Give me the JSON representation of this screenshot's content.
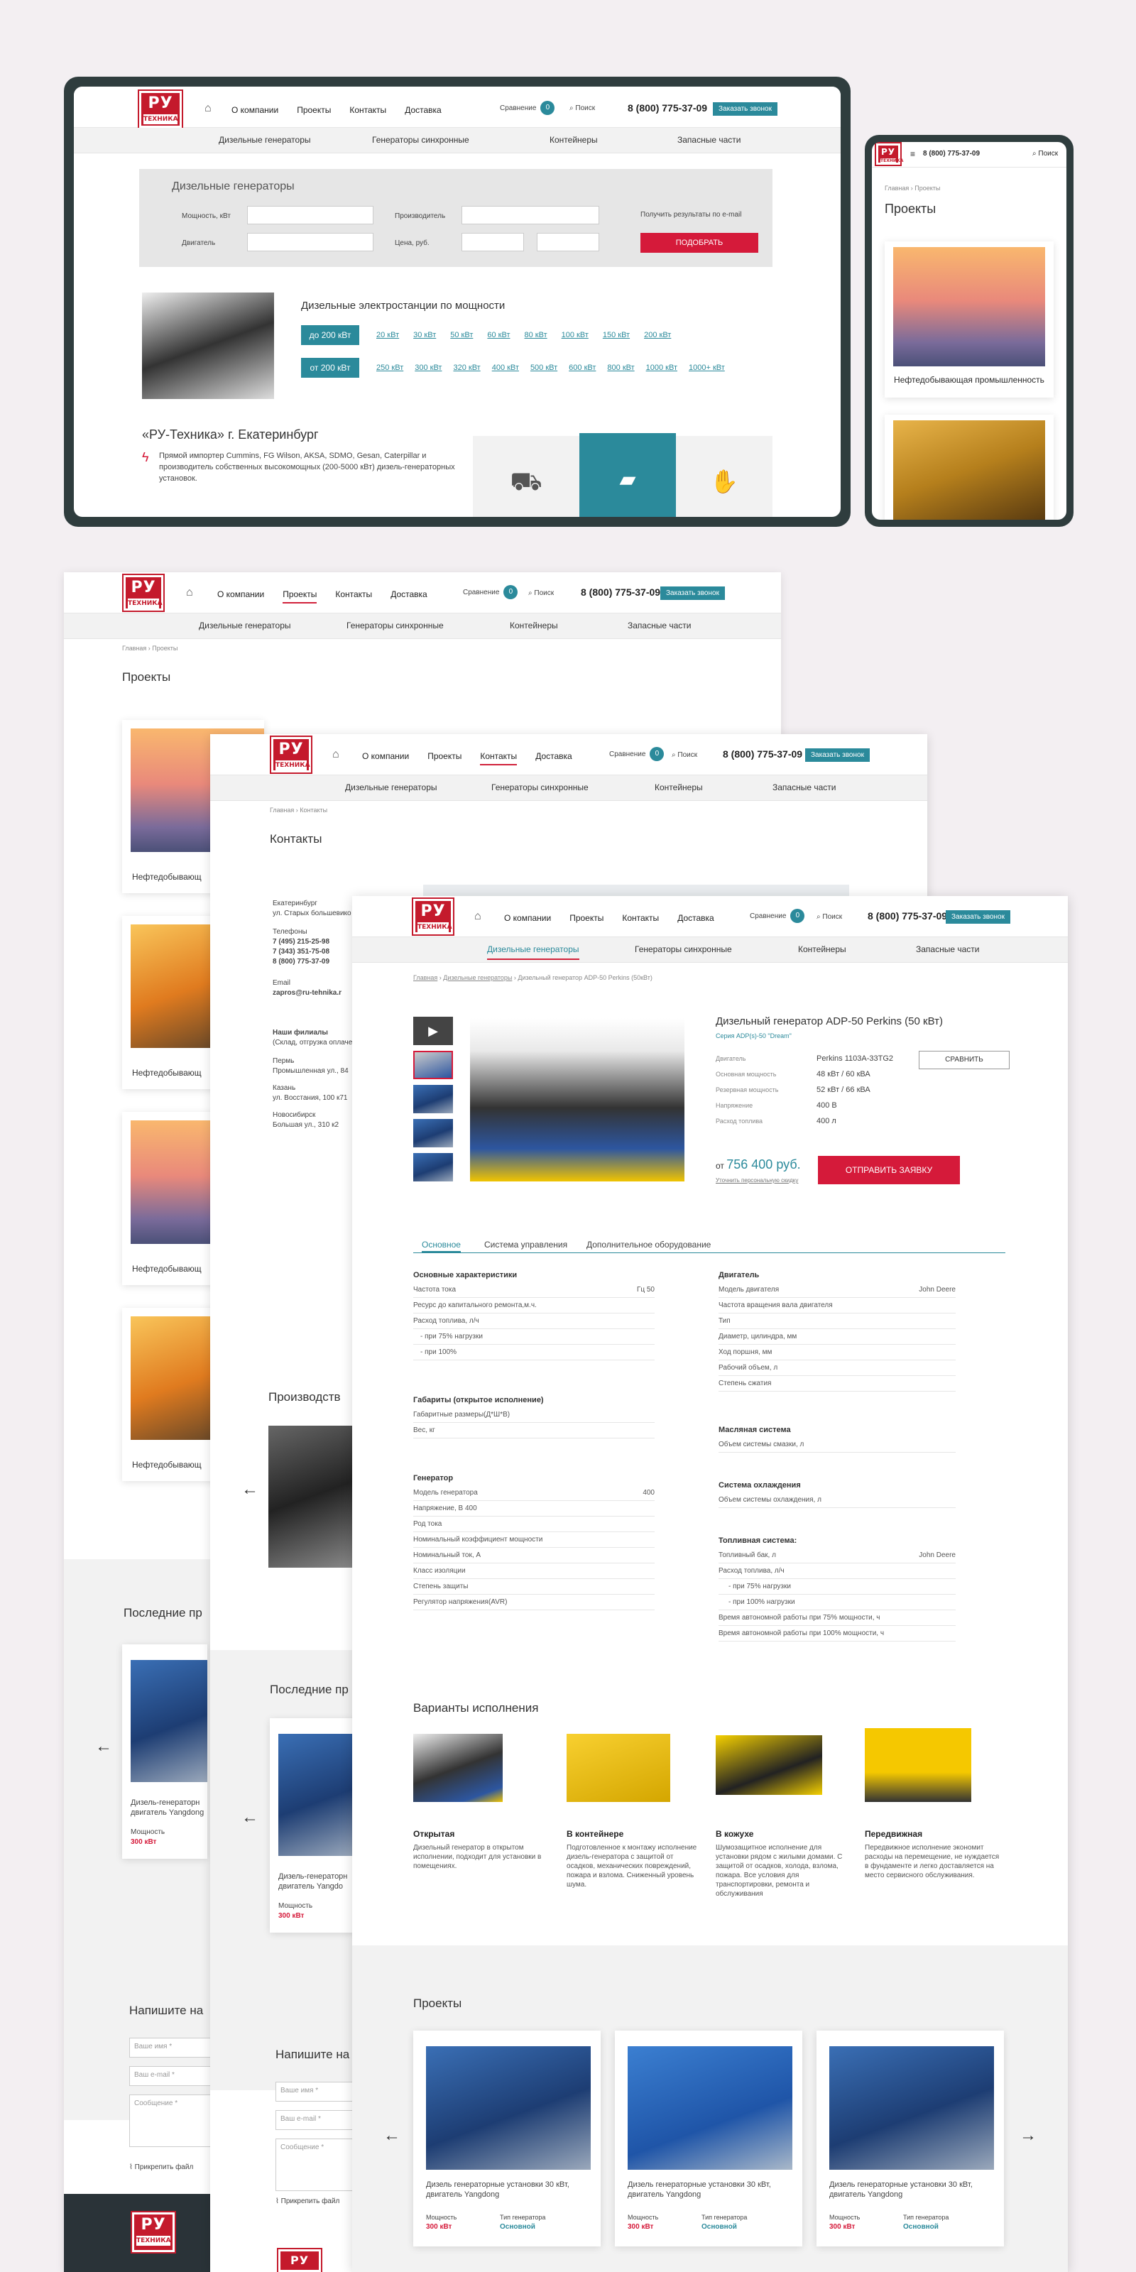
{
  "company": {
    "logo_top": "РУ",
    "logo_bottom": "ТЕХНИКА"
  },
  "nav": {
    "about": "О компании",
    "projects": "Проекты",
    "contacts": "Контакты",
    "delivery": "Доставка",
    "compare": "Сравнение",
    "compare_count": "0",
    "search": "Поиск",
    "phone": "8 (800) 775-37-09",
    "call": "Заказать звонок"
  },
  "subnav": [
    "Дизельные генераторы",
    "Генераторы синхронные",
    "Контейнеры",
    "Запасные части"
  ],
  "home": {
    "filter_title": "Дизельные генераторы",
    "power_label": "Мощность, кВт",
    "maker_label": "Производитель",
    "engine_label": "Двигатель",
    "price_label": "Цена, руб.",
    "email_results": "Получить результаты по e-mail",
    "pick_button": "ПОДОБРАТЬ",
    "power_title": "Дизельные электростанции по мощности",
    "up_to": "до 200 кВт",
    "from": "от 200 кВт",
    "row1": [
      "20 кВт",
      "30 кВт",
      "50 кВт",
      "60 кВт",
      "80 кВт",
      "100 кВт",
      "150 кВт",
      "200 кВт"
    ],
    "row2": [
      "250 кВт",
      "300 кВт",
      "320 кВт",
      "400 кВт",
      "500 кВт",
      "600 кВт",
      "800 кВт",
      "1000 кВт",
      "1000+ кВт"
    ],
    "about_title": "«РУ-Техника» г. Екатеринбург",
    "about_text": "Прямой импортер Cummins, FG Wilson, AKSA, SDMO, Gesan, Caterpillar и производитель собственных высокомощных (200-5000 кВт) дизель-генераторных установок."
  },
  "mobile": {
    "crumb_home": "Главная",
    "crumb_cur": "Проекты",
    "title": "Проекты",
    "card1": "Нефтедобывающая промышленность"
  },
  "projects": {
    "crumb_home": "Главная",
    "crumb_cur": "Проекты",
    "title": "Проекты",
    "card": "Нефтедобывающ",
    "producer": "Производств",
    "last": "Последние пр",
    "write": "Напишите на",
    "item_title": "Дизель-генераторн двигатель Yangdong",
    "power_label": "Мощность",
    "power_val": "300 кВт",
    "name_ph": "Ваше имя *",
    "email_ph": "Ваш e-mail *",
    "msg_ph": "Сообщение *",
    "attach": "Прикрепить файл"
  },
  "contacts": {
    "crumb_home": "Главная",
    "crumb_cur": "Контакты",
    "title": "Контакты",
    "city": "Екатеринбург",
    "street": "ул. Старых большевико",
    "phones_label": "Телефоны",
    "p1": "7 (495) 215-25-98",
    "p2": "7 (343) 351-75-08",
    "p3": "8 (800) 775-37-09",
    "email_label": "Email",
    "email": "zapros@ru-tehnika.r",
    "branches": "Наши филиалы",
    "branches_sub": "(Склад, отгрузка оплаче",
    "perm": "Пермь",
    "perm_addr": "Промышленная ул., 84",
    "kazan": "Казань",
    "kazan_addr": "ул. Восстания, 100 к71",
    "nsk": "Новосибирск",
    "nsk_addr": "Большая ул., 310 к2",
    "producer": "Производств",
    "last": "Последние пр",
    "item_title": "Дизель-генераторн двигатель Yangdo",
    "power_label": "Мощность",
    "power_val": "300 кВт",
    "write": "Напишите на",
    "name_ph": "Ваше имя *",
    "email_ph": "Ваш e-mail *",
    "msg_ph": "Сообщение *",
    "attach": "Прикрепить файл"
  },
  "product": {
    "crumb": [
      "Главная",
      "Дизельные генераторы",
      "Дизельный генератор ADP-50 Perkins (50кВт)"
    ],
    "title": "Дизельный генератор ADP-50 Perkins (50 кВт)",
    "series": "Серия ADP(s)-50 \"Dream\"",
    "specs": [
      [
        "Двигатель",
        "Perkins 1103A-33TG2"
      ],
      [
        "Основная мощность",
        "48 кВт / 60 кВА"
      ],
      [
        "Резервная мощность",
        "52 кВт / 66 кВА"
      ],
      [
        "Напряжение",
        "400 В"
      ],
      [
        "Расход топлива",
        "400 л"
      ]
    ],
    "compare_btn": "СРАВНИТЬ",
    "price_from": "от",
    "price": "756 400 руб.",
    "price_link": "Уточнить персональную скидку",
    "order_btn": "ОТПРАВИТЬ ЗАЯВКУ",
    "tabs": [
      "Основное",
      "Система управления",
      "Дополнительное оборудование"
    ],
    "main_title": "Основные характеристики",
    "main_rows": [
      [
        "Частота тока",
        "Гц 50"
      ],
      [
        "Ресурс до капитального ремонта,м.ч.",
        ""
      ],
      [
        "Расход топлива, л/ч",
        ""
      ],
      [
        "- при 75% нагрузки",
        ""
      ],
      [
        "- при 100%",
        ""
      ]
    ],
    "dims_title": "Габариты (открытое исполнение)",
    "dims_rows": [
      [
        "Габаритные размеры(Д*Ш*В)",
        ""
      ],
      [
        "Вес, кг",
        ""
      ]
    ],
    "gen_title": "Генератор",
    "gen_rows": [
      [
        "Модель генератора",
        "400"
      ],
      [
        "Напряжение, В 400",
        ""
      ],
      [
        "Род тока",
        ""
      ],
      [
        "Номинальный коэффициент мощности",
        ""
      ],
      [
        "Номинальный ток, А",
        ""
      ],
      [
        "Класс изоляции",
        ""
      ],
      [
        "Степень защиты",
        ""
      ],
      [
        "Регулятор напряжения(AVR)",
        ""
      ]
    ],
    "eng_title": "Двигатель",
    "eng_rows": [
      [
        "Модель двигателя",
        "John Deere"
      ],
      [
        "Частота вращения вала двигателя",
        ""
      ],
      [
        "Тип",
        ""
      ],
      [
        "Диаметр, цилиндра, мм",
        ""
      ],
      [
        "Ход поршня, мм",
        ""
      ],
      [
        "Рабочий объем, л",
        ""
      ],
      [
        "Степень сжатия",
        ""
      ]
    ],
    "oil_title": "Масляная система",
    "oil_rows": [
      [
        "Объем системы смазки, л",
        ""
      ]
    ],
    "cool_title": "Система охлаждения",
    "cool_rows": [
      [
        "Объем системы охлаждения, л",
        ""
      ]
    ],
    "fuel_title": "Топливная система:",
    "fuel_rows": [
      [
        "Топливный бак, л",
        "John Deere"
      ],
      [
        "Расход топлива, л/ч",
        ""
      ],
      [
        "- при 75% нагрузки",
        ""
      ],
      [
        "- при 100% нагрузки",
        ""
      ],
      [
        "Время автономной работы при 75% мощности, ч",
        ""
      ],
      [
        "Время автономной работы при 100% мощности, ч",
        ""
      ]
    ],
    "variants_title": "Варианты исполнения",
    "variants": [
      {
        "name": "Открытая",
        "text": "Дизельный генератор в открытом исполнении, подходит для установки в помещениях."
      },
      {
        "name": "В контейнере",
        "text": "Подготовленное к монтажу исполнение дизель-генератора с защитой от осадков, механических повреждений, пожара и взлома. Сниженный уровень шума."
      },
      {
        "name": "В кожухе",
        "text": "Шумозащитное исполнение для установки рядом с жилыми домами. С защитой от осадков, холода, взлома, пожара. Все условия для транспортировки, ремонта и обслуживания"
      },
      {
        "name": "Передвижная",
        "text": "Передвижное исполнение экономит расходы на перемещение, не нуждается в фундаменте и легко доставляется на место сервисного обслуживания."
      }
    ],
    "projects_title": "Проекты",
    "proj_items": [
      {
        "title": "Дизель генераторные установки 30 кВт, двигатель Yangdong",
        "power": "300 кВт",
        "type": "Основной"
      },
      {
        "title": "Дизель генераторные установки 30 кВт, двигатель Yangdong",
        "power": "300 кВт",
        "type": "Основной"
      },
      {
        "title": "Дизель генераторные установки 30 кВт, двигатель Yangdong",
        "power": "300 кВт",
        "type": "Основной"
      }
    ],
    "power_label": "Мощность",
    "type_label": "Тип генератора"
  }
}
